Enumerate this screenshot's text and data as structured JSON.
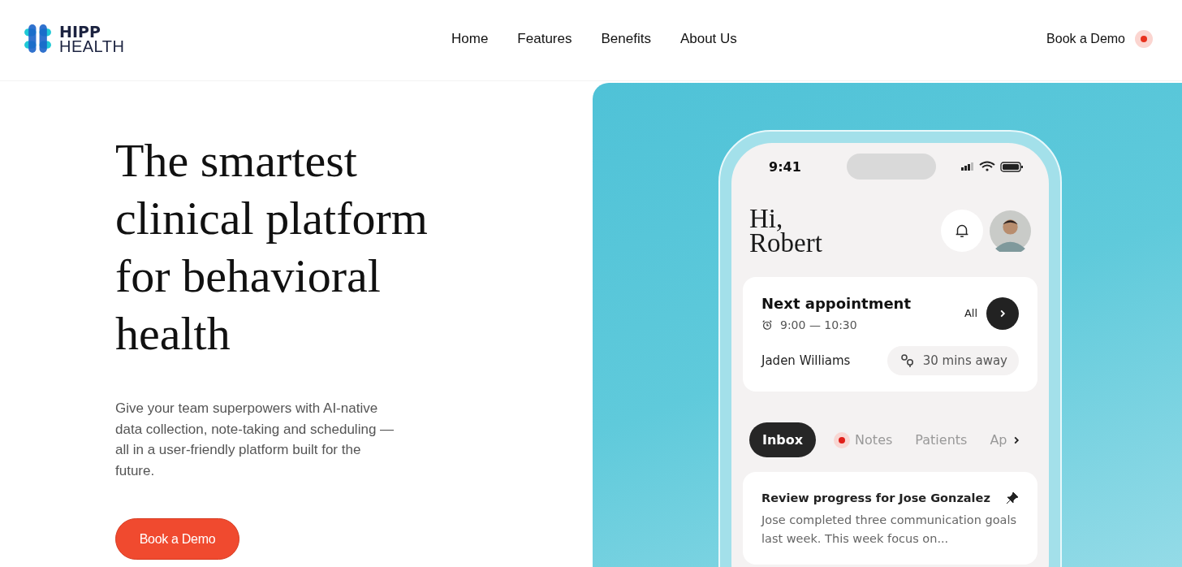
{
  "brand": {
    "line_1": "HIPP",
    "line_2": "HEALTH"
  },
  "nav": [
    {
      "label": "Home"
    },
    {
      "label": "Features"
    },
    {
      "label": "Benefits"
    },
    {
      "label": "About Us"
    }
  ],
  "header_cta": {
    "label": "Book a Demo",
    "dot": true
  },
  "hero": {
    "title": "The smartest clinical platform for behavioral health",
    "text": "Give your team superpowers with AI-native data collection, note-taking and scheduling  — all in a user-friendly platform built for the future.",
    "button": "Book a Demo"
  },
  "phone": {
    "time": "9:41",
    "greeting_1": "Hi,",
    "greeting_2": "Robert",
    "appointment": {
      "title": "Next appointment",
      "time": "9:00 — 10:30",
      "link": "All",
      "person": "Jaden Williams",
      "distance": "30 mins away"
    },
    "tabs": [
      {
        "label": "Inbox",
        "selected": true,
        "dot": false
      },
      {
        "label": "Notes",
        "selected": false,
        "dot": true
      },
      {
        "label": "Patients",
        "selected": false,
        "dot": false
      },
      {
        "label": "Ap",
        "selected": false,
        "dot": false
      }
    ],
    "message": {
      "title": "Review progress for Jose Gonzalez",
      "pinned": true,
      "text": "Jose completed three communication goals last week. This week focus on..."
    }
  }
}
